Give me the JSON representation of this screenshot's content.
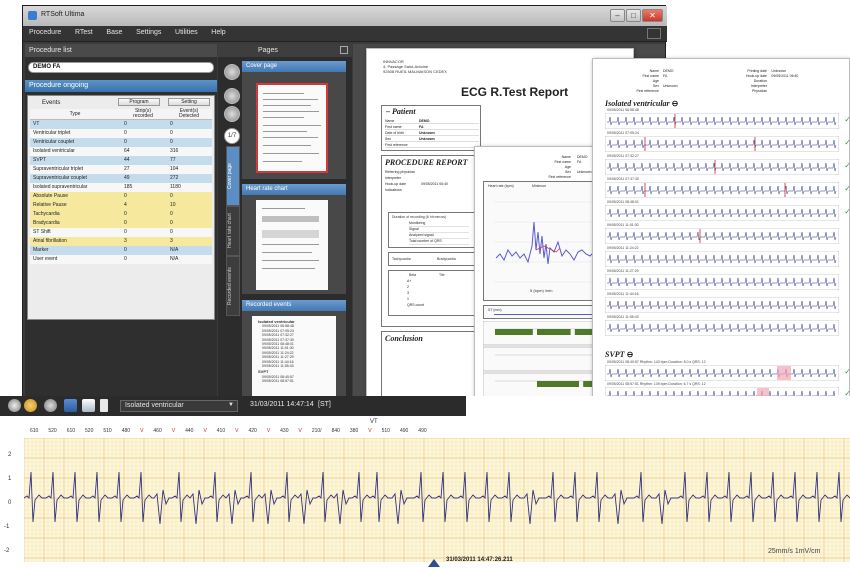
{
  "app": {
    "title": "RTSoft Ultima"
  },
  "menu": [
    "Procedure",
    "RTest",
    "Base",
    "Settings",
    "Utilities",
    "Help"
  ],
  "left_panel": {
    "procedure_list_title": "Procedure list",
    "procedure_value": "DEMO FA",
    "procedure_ongoing_title": "Procedure ongoing",
    "events_label": "Events",
    "program_button": "Program",
    "setting_button": "Setting",
    "columns": [
      "Type",
      "Strip(s)\nrecorded",
      "Event(s)\nDetected"
    ],
    "rows": [
      {
        "type": "VT",
        "strips": "0",
        "detected": "0"
      },
      {
        "type": "Ventricular triplet",
        "strips": "0",
        "detected": "0"
      },
      {
        "type": "Ventricular couplet",
        "strips": "0",
        "detected": "0"
      },
      {
        "type": "Isolated ventricular",
        "strips": "64",
        "detected": "316"
      },
      {
        "type": "SVPT",
        "strips": "44",
        "detected": "77"
      },
      {
        "type": "Supraventricular triplet",
        "strips": "27",
        "detected": "104"
      },
      {
        "type": "Supraventricular couplet",
        "strips": "49",
        "detected": "272"
      },
      {
        "type": "Isolated supraventricular",
        "strips": "185",
        "detected": "1180"
      },
      {
        "type": "Absolute Pause",
        "strips": "0",
        "detected": "0"
      },
      {
        "type": "Relative Pause",
        "strips": "4",
        "detected": "10"
      },
      {
        "type": "Tachycardia",
        "strips": "0",
        "detected": "0"
      },
      {
        "type": "Bradycardia",
        "strips": "0",
        "detected": "0"
      },
      {
        "type": "ST Shift",
        "strips": "0",
        "detected": "0"
      },
      {
        "type": "Atrial fibrillation",
        "strips": "3",
        "detected": "3"
      },
      {
        "type": "Marker",
        "strips": "0",
        "detected": "N/A"
      },
      {
        "type": "User event",
        "strips": "0",
        "detected": "N/A"
      }
    ]
  },
  "pages_panel": {
    "title": "Pages",
    "page_counter": "1/7",
    "tabs": [
      "Cover page",
      "Heart rate chart",
      "Recorded events"
    ],
    "groups": [
      "Cover page",
      "Heart rate chart",
      "Recorded events"
    ],
    "recorded_events_preview": {
      "heading1": "Isolated ventricular",
      "items1": [
        "09/05/2011 06:58:48",
        "09/05/2011 07:05:24",
        "09/05/2011 07:32:27",
        "09/05/2011 07:37:30",
        "09/05/2011 08:48:01",
        "09/05/2011 11:01:30",
        "09/05/2011 11:24:22",
        "09/05/2011 11:27:29",
        "09/05/2011 11:44:16",
        "09/05/2011 11:55:43"
      ],
      "heading2": "SVPT",
      "items2": [
        "09/05/2011 08:40:57",
        "09/05/2011 08:57:51"
      ]
    }
  },
  "report": {
    "address": [
      "INNVACOR",
      "4, Passage Saint-Antoine",
      "92508 RUEIL MALMAISON CEDEX"
    ],
    "title": "ECG R.Test Report",
    "patient_section": "Patient",
    "patient_fields": [
      {
        "label": "Name",
        "value": "DEMO"
      },
      {
        "label": "First name",
        "value": "FA"
      },
      {
        "label": "Date of birth",
        "value": "Unknown"
      },
      {
        "label": "Sex",
        "value": "Unknown"
      },
      {
        "label": "First reference",
        "value": ""
      }
    ],
    "procedure_section": "PROCEDURE REPORT",
    "procedure_fields": [
      "Referring physician",
      "Interpreter",
      "Hook-up date",
      "Indications"
    ],
    "hookup_date": "09/05/2011 06:40",
    "recording_duration_label": "Duration of recording (6 hh:mm:ss)",
    "recording_rows": [
      "Monitoring",
      "Signal",
      "Analyzed signal",
      "Total number of QRS"
    ],
    "tachy_label": "Tachycardia",
    "brady_label": "Bradycardia",
    "qrs_table_headers": [
      "Beta",
      "Tile"
    ],
    "qrs_table_rows": [
      "A+",
      "2",
      "3",
      "1",
      "QRS count"
    ],
    "conclusion_section": "Conclusion"
  },
  "hr_page": {
    "header_fields": [
      {
        "label": "Name",
        "value": "DEMO"
      },
      {
        "label": "First name",
        "value": "FA"
      },
      {
        "label": "Age",
        "value": ""
      },
      {
        "label": "Sex",
        "value": "Unknown"
      },
      {
        "label": "First reference",
        "value": ""
      }
    ],
    "chart_label": "Heart rate (bpm)",
    "chart_mode": "Minimum",
    "st_label": "ST (mm)",
    "axis_label": "5 (bpm) /min",
    "page_label": "Page 4"
  },
  "events_page": {
    "header_left": [
      {
        "label": "Name",
        "value": "DEMO"
      },
      {
        "label": "First name",
        "value": "FA"
      },
      {
        "label": "Age",
        "value": ""
      },
      {
        "label": "Sex",
        "value": "Unknown"
      },
      {
        "label": "First reference",
        "value": ""
      }
    ],
    "header_right": [
      {
        "label": "Printing date",
        "value": "Unknown"
      },
      {
        "label": "Hook-up date",
        "value": "09/05/2011 06:40"
      },
      {
        "label": "Duration",
        "value": ""
      },
      {
        "label": "Interpreter",
        "value": ""
      },
      {
        "label": "Physician",
        "value": ""
      }
    ],
    "section1": "Isolated ventricular",
    "strips1": [
      "09/05/2011 06:58:48",
      "09/05/2011 07:05:24",
      "09/05/2011 07:32:27",
      "09/05/2011 07:37:30",
      "09/05/2011 08:48:01",
      "09/05/2011 11:01:30",
      "09/05/2011 11:24:22",
      "09/05/2011 11:27:29",
      "09/05/2011 11:44:16",
      "09/05/2011 11:55:43"
    ],
    "section2": "SVPT",
    "strips2": [
      "09/05/2011 08:40:57   Rhythm: 143 bpm   Duration: 8.0 s   QRS: 12",
      "09/05/2011 08:57:51   Rhythm: 139 bpm   Duration: 6.7 s   QRS: 12"
    ],
    "page_label": "Page"
  },
  "ecg": {
    "event_select": "Isolated ventricular",
    "datetime": "31/03/2011 14:47:14",
    "st_label": "[ST]",
    "rhythm_label": "VT",
    "rr_values": [
      "610",
      "520",
      "610",
      "520",
      "510",
      "480",
      "V",
      "460",
      "V",
      "440",
      "V",
      "410",
      "V",
      "420",
      "V",
      "430",
      "V",
      "210/",
      "840",
      "380",
      "V",
      "510",
      "490",
      "490"
    ],
    "y_labels": [
      "2",
      "1",
      "0",
      "-1",
      "-2"
    ],
    "scale": "25mm/s  1mV/cm",
    "cursor_time": "31/03/2011 14:47:26.211"
  }
}
